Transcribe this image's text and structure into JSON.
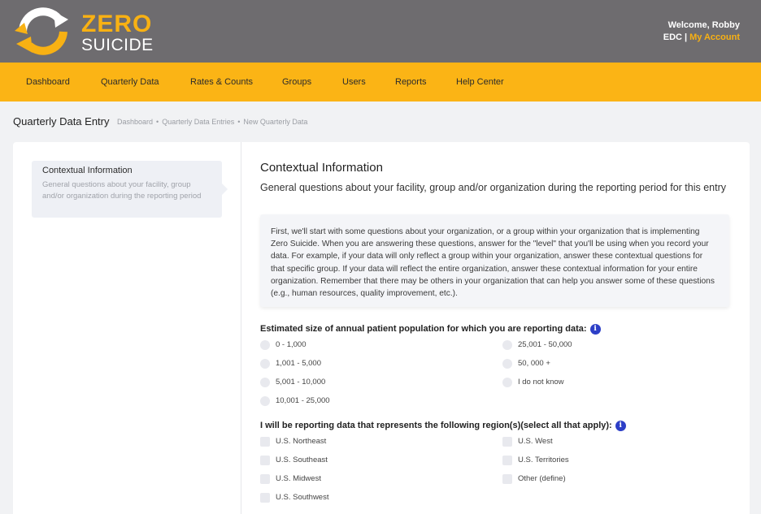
{
  "brand": {
    "line1": "ZERO",
    "line2": "SUICIDE",
    "accent": "#f8b113",
    "header_bg": "#6e6c6f",
    "nav_bg": "#fbb415"
  },
  "user": {
    "welcome": "Welcome, Robby",
    "org": "EDC",
    "separator": "|",
    "account_link": "My Account"
  },
  "nav": {
    "dashboard": "Dashboard",
    "quarterly_data": "Quarterly Data",
    "rates_counts": "Rates & Counts",
    "groups": "Groups",
    "users": "Users",
    "reports": "Reports",
    "help_center": "Help Center"
  },
  "page": {
    "title": "Quarterly Data Entry",
    "breadcrumbs": [
      "Dashboard",
      "Quarterly Data Entries",
      "New Quarterly Data"
    ]
  },
  "sidebar": {
    "step_title": "Contextual Information",
    "step_desc": "General questions about your facility, group and/or organization during the reporting period"
  },
  "section": {
    "title": "Contextual Information",
    "subtitle": "General questions about your facility, group and/or organization during the reporting period for this entry",
    "intro": "First, we'll start with some questions about your organization, or a group within your organization that is implementing Zero Suicide. When you are answering these questions, answer for the \"level\" that you'll be using when you record your data. For example, if your data will only reflect a group within your organization, answer these contextual questions for that specific group. If your data will reflect the entire organization, answer these contextual information for your entire organization. Remember that there may be others in your organization that can help you answer some of these questions (e.g., human resources, quality improvement, etc.)."
  },
  "q1": {
    "label": "Estimated size of annual patient population for which you are reporting data:",
    "options": [
      "0 - 1,000",
      "1,001 - 5,000",
      "5,001 - 10,000",
      "10,001 - 25,000",
      "25,001 - 50,000",
      "50, 000 +",
      "I do not know"
    ]
  },
  "q2": {
    "label": "I will be reporting data that represents the following region(s)(select all that apply):",
    "options": [
      "U.S. Northeast",
      "U.S. Southeast",
      "U.S. Midwest",
      "U.S. Southwest",
      "U.S. West",
      "U.S. Territories",
      "Other (define)"
    ]
  },
  "icons": {
    "info": "info-icon",
    "logo": "recycle-arrows-logo"
  }
}
